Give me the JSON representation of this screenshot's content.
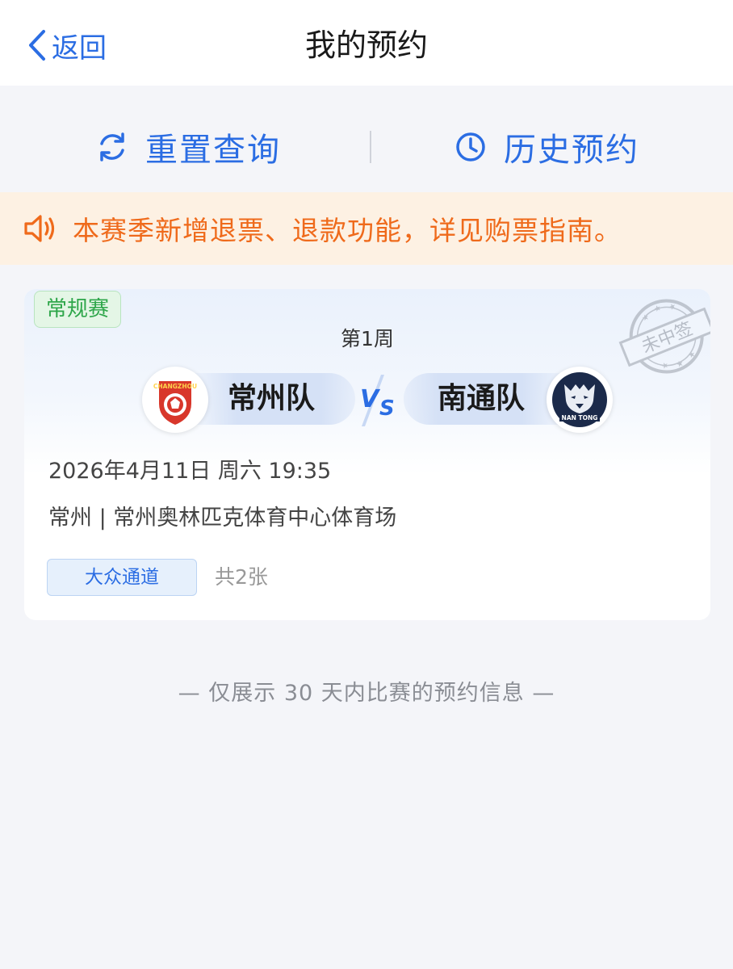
{
  "nav": {
    "back_label": "返回",
    "title": "我的预约"
  },
  "actions": {
    "reset_label": "重置查询",
    "history_label": "历史预约"
  },
  "notice": {
    "text": "本赛季新增退票、退款功能，详见购票指南。"
  },
  "reservation": {
    "type_tag": "常规赛",
    "stamp_text": "未中签",
    "round": "第1周",
    "home_team": {
      "name": "常州队",
      "logo_text": "CHANGZHOU"
    },
    "away_team": {
      "name": "南通队",
      "logo_text": "NAN TONG"
    },
    "vs_label": "VS",
    "datetime": "2026年4月11日 周六 19:35",
    "venue": "常州 | 常州奥林匹克体育中心体育场",
    "channel": "大众通道",
    "ticket_count": "共2张"
  },
  "footer": {
    "hint": "— 仅展示 30 天内比赛的预约信息 —"
  },
  "colors": {
    "primary": "#2b6de3",
    "notice_bg": "#fdf1e3",
    "notice_text": "#ef6a1b",
    "tag_green": "#2ea64a"
  }
}
